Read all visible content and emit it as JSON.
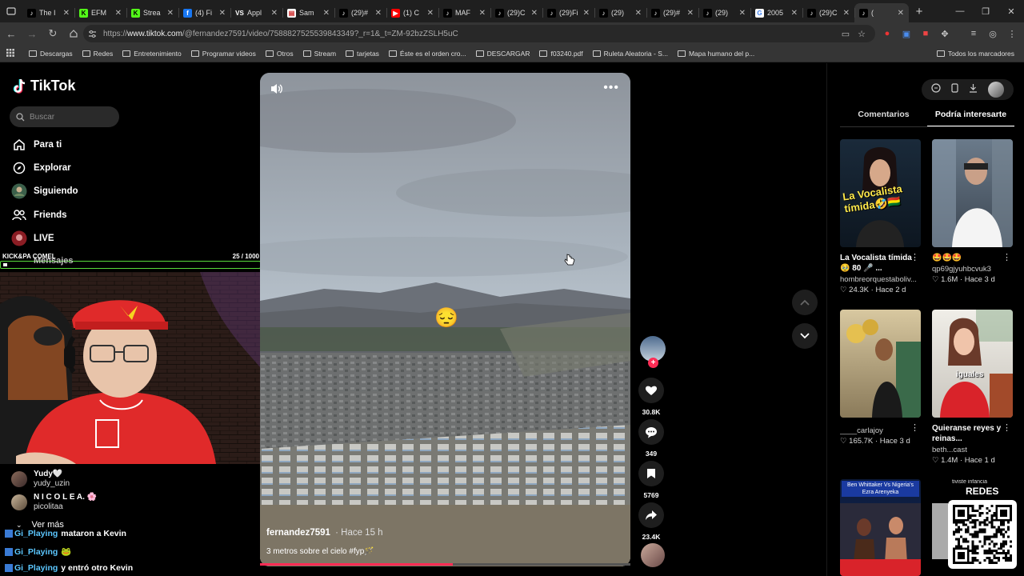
{
  "browser": {
    "tabs": [
      {
        "title": "The I",
        "icon": "tiktok-icon"
      },
      {
        "title": "EFM",
        "icon": "kick-icon"
      },
      {
        "title": "Strea",
        "icon": "kick-icon"
      },
      {
        "title": "(4) Fi",
        "icon": "facebook-icon"
      },
      {
        "title": "Appl",
        "icon": "vs-icon"
      },
      {
        "title": "Sam",
        "icon": "doc-icon"
      },
      {
        "title": "(29)#",
        "icon": "tiktok-icon"
      },
      {
        "title": "(1) C",
        "icon": "youtube-icon"
      },
      {
        "title": "MAF",
        "icon": "tiktok-icon"
      },
      {
        "title": "(29)C",
        "icon": "tiktok-icon"
      },
      {
        "title": "(29)Fi",
        "icon": "tiktok-icon"
      },
      {
        "title": "(29)",
        "icon": "tiktok-icon"
      },
      {
        "title": "(29)#",
        "icon": "tiktok-icon"
      },
      {
        "title": "(29)",
        "icon": "tiktok-icon"
      },
      {
        "title": "2005",
        "icon": "google-icon"
      },
      {
        "title": "(29)C",
        "icon": "tiktok-icon"
      },
      {
        "title": "(",
        "icon": "tiktok-icon",
        "active": true
      }
    ],
    "url_prefix": "https://",
    "url_host": "www.tiktok.com",
    "url_path": "/@fernandez7591/video/7588827525539843349?_r=1&_t=ZM-92bzZSLH5uC",
    "bookmarks": [
      "Descargas",
      "Redes",
      "Entretenimiento",
      "Programar videos",
      "Otros",
      "Stream",
      "tarjetas",
      "Éste es el orden cro...",
      "DESCARGAR",
      "f03240.pdf",
      "Ruleta Aleatoria - S...",
      "Mapa humano del p..."
    ],
    "all_bookmarks": "Todos los marcadores"
  },
  "sidebar": {
    "logo": "TikTok",
    "search_placeholder": "Buscar",
    "nav": [
      {
        "label": "Para ti",
        "icon": "home-icon"
      },
      {
        "label": "Explorar",
        "icon": "compass-icon"
      },
      {
        "label": "Siguiendo",
        "icon": "following-avatar-icon"
      },
      {
        "label": "Friends",
        "icon": "friends-icon"
      },
      {
        "label": "LIVE",
        "icon": "live-icon"
      },
      {
        "label": "Mensajes",
        "icon": "messages-icon"
      }
    ],
    "following": [
      {
        "name": "Yudy🤍",
        "handle": "yudy_uzin"
      },
      {
        "name": "N I C O L E A. 🌸",
        "handle": "picolitaa"
      }
    ],
    "see_more": "Ver más"
  },
  "stream_overlay": {
    "label": "KICK&PA COMEL",
    "counter": "25  / 1000",
    "chat": [
      {
        "user": "Gi_Playing",
        "text": "mataron a Kevin"
      },
      {
        "user": "Gi_Playing",
        "text": "🐸"
      },
      {
        "user": "Gi_Playing",
        "text": "y entró otro Kevin"
      }
    ],
    "redes": "REDES"
  },
  "video": {
    "author": "fernandez7591",
    "time": "· Hace 15 h",
    "caption": "3 metros sobre el cielo #fyp🪄",
    "emoji": "😔",
    "progress": 0.52
  },
  "actions": {
    "likes": "30.8K",
    "comments": "349",
    "saves": "5769",
    "shares": "23.4K"
  },
  "right_panel": {
    "tabs": [
      "Comentarios",
      "Podría interesarte"
    ],
    "active_tab": 1,
    "cards": [
      {
        "title": "La Vocalista tímida",
        "title2": "🥹 80 🎤 ...",
        "user": "hombreorquestaboliv...",
        "likes": "24.3K",
        "age": "Hace 2 d",
        "overlay": "La Vocalista tímida🤣🇧🇴"
      },
      {
        "title": "🤩🤩🤩",
        "title2": "",
        "user": "qp69gjyuhbcvuk3",
        "likes": "1.6M",
        "age": "Hace 3 d",
        "overlay": ""
      },
      {
        "title": "",
        "title2": "",
        "user": "____carlajoy",
        "likes": "165.7K",
        "age": "Hace 3 d",
        "overlay": ""
      },
      {
        "title": "Quieranse reyes y",
        "title2": "reinas...",
        "user": "beth...cast",
        "likes": "1.4M",
        "age": "Hace 1 d",
        "overlay": "iguales"
      },
      {
        "title": "",
        "title2": "",
        "user": "",
        "likes": "",
        "age": "",
        "overlay": "Ben Whittaker Vs Nigeria's Ezra Arenyeka"
      },
      {
        "title": "",
        "title2": "",
        "user": "",
        "likes": "",
        "age": "",
        "overlay": "tiviste infancia"
      }
    ]
  }
}
